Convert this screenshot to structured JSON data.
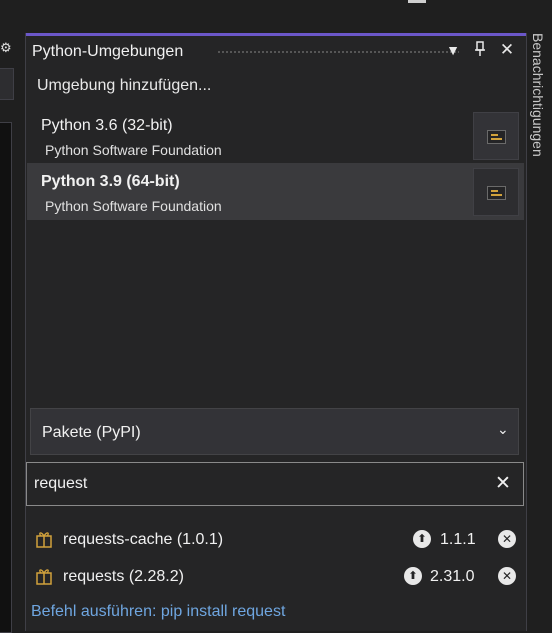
{
  "panel": {
    "title": "Python-Umgebungen",
    "add_environment": "Umgebung hinzufügen..."
  },
  "environments": [
    {
      "name": "Python 3.6 (32-bit)",
      "publisher": "Python Software Foundation",
      "selected": false
    },
    {
      "name": "Python 3.9 (64-bit)",
      "publisher": "Python Software Foundation",
      "selected": true
    }
  ],
  "package_source": {
    "selected": "Pakete (PyPI)"
  },
  "search": {
    "value": "request"
  },
  "packages": [
    {
      "name": "requests-cache (1.0.1)",
      "update_version": "1.1.1"
    },
    {
      "name": "requests (2.28.2)",
      "update_version": "2.31.0"
    }
  ],
  "pip_command": "Befehl ausführen: pip install request",
  "side_tab": "Benachrichtigungen",
  "colors": {
    "accent": "#6b57c9",
    "link": "#6fa6e0",
    "package_icon": "#d1a23c"
  }
}
